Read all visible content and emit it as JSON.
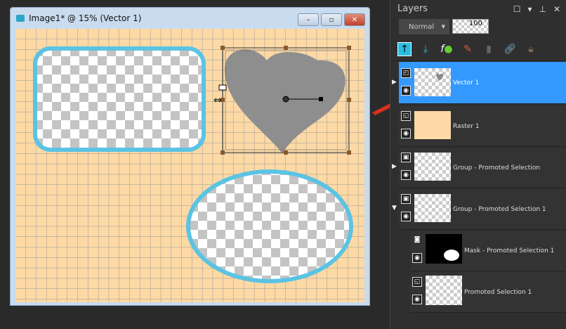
{
  "window": {
    "title": "Image1* @  15% (Vector 1)",
    "minimize": "–",
    "restore": "▫",
    "close": "✕"
  },
  "colors": {
    "canvas_bg": "#fcd9a5",
    "shape_border": "#5bc3e3",
    "heart": "#8e8e8e",
    "selected_layer": "#3399ff",
    "arrow": "#d9301c"
  },
  "layers_panel": {
    "title": "Layers",
    "blend_mode": "Normal",
    "opacity": "100",
    "tools": [
      "new-raster-layer",
      "new-vector-layer",
      "layer-effects",
      "edit-layer",
      "delete-layer",
      "link",
      "lock"
    ],
    "layers": [
      {
        "name": "Vector 1",
        "selected": true
      },
      {
        "name": "Raster 1"
      },
      {
        "name": "Group - Promoted Selection"
      },
      {
        "name": "Group - Promoted Selection 1"
      },
      {
        "name": "Mask - Promoted Selection 1"
      },
      {
        "name": "Promoted Selection 1"
      }
    ]
  }
}
